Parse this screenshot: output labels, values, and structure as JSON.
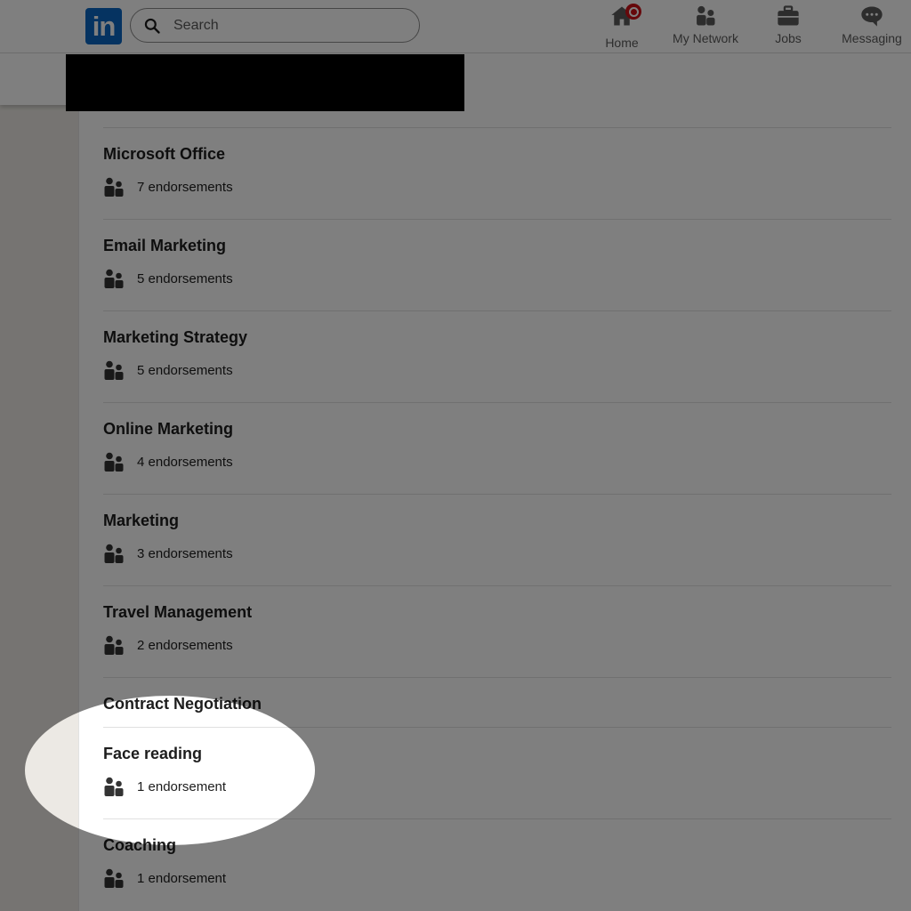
{
  "nav": {
    "logo": "in",
    "search_placeholder": "Search",
    "items": [
      {
        "label": "Home",
        "icon": "home-icon"
      },
      {
        "label": "My Network",
        "icon": "people-icon"
      },
      {
        "label": "Jobs",
        "icon": "briefcase-icon"
      },
      {
        "label": "Messaging",
        "icon": "chat-icon"
      }
    ]
  },
  "skills": [
    {
      "name": "Microsoft Office",
      "endorsements": "7 endorsements"
    },
    {
      "name": "Email Marketing",
      "endorsements": "5 endorsements"
    },
    {
      "name": "Marketing Strategy",
      "endorsements": "5 endorsements"
    },
    {
      "name": "Online Marketing",
      "endorsements": "4 endorsements"
    },
    {
      "name": "Marketing",
      "endorsements": "3 endorsements"
    },
    {
      "name": "Travel Management",
      "endorsements": "2 endorsements"
    },
    {
      "name": "Contract Negotiation",
      "endorsements": ""
    },
    {
      "name": "Face reading",
      "endorsements": "1 endorsement"
    },
    {
      "name": "Coaching",
      "endorsements": "1 endorsement"
    }
  ],
  "colors": {
    "brand": "#0a66c2",
    "notification": "#cc1016",
    "overlay": "rgba(0,0,0,0.5)"
  }
}
